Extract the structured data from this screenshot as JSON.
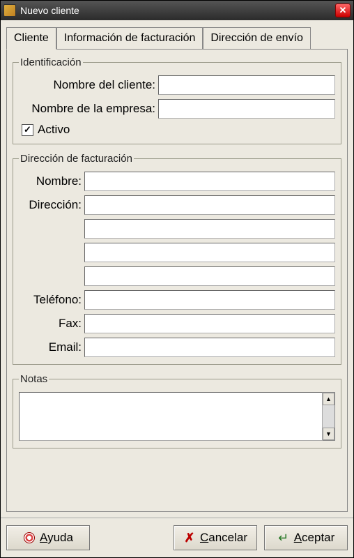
{
  "window": {
    "title": "Nuevo cliente"
  },
  "tabs": {
    "client": "Cliente",
    "billing_info": "Información de facturación",
    "shipping": "Dirección de envío"
  },
  "identification": {
    "legend": "Identificación",
    "client_name_label": "Nombre del cliente:",
    "client_name_value": "",
    "company_name_label": "Nombre de la empresa:",
    "company_name_value": "",
    "active_label": "Activo",
    "active_checked": true
  },
  "billing": {
    "legend": "Dirección de facturación",
    "name_label": "Nombre:",
    "name_value": "",
    "address_label": "Dirección:",
    "addr1": "",
    "addr2": "",
    "addr3": "",
    "addr4": "",
    "phone_label": "Teléfono:",
    "phone_value": "",
    "fax_label": "Fax:",
    "fax_value": "",
    "email_label": "Email:",
    "email_value": ""
  },
  "notes": {
    "legend": "Notas",
    "value": ""
  },
  "buttons": {
    "help": "Ayuda",
    "cancel": "Cancelar",
    "accept": "Aceptar"
  }
}
